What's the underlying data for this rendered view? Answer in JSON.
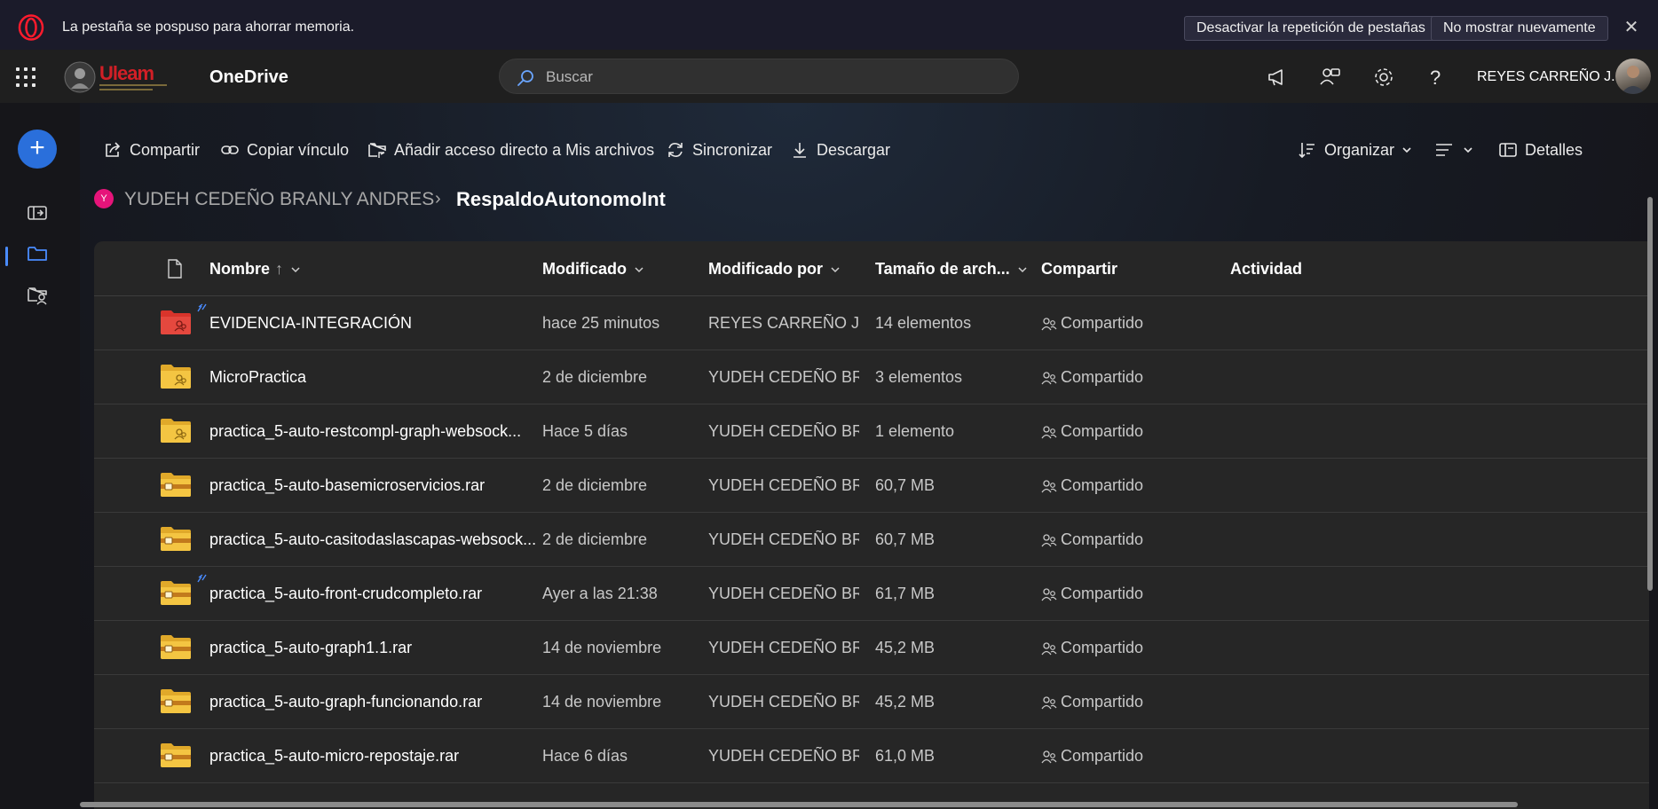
{
  "notification": {
    "text": "La pestaña se pospuso para ahorrar memoria.",
    "btn_disable": "Desactivar la repetición de pestañas",
    "btn_dont_show": "No mostrar nuevamente",
    "close": "✕"
  },
  "header": {
    "app_title": "OneDrive",
    "search_placeholder": "Buscar",
    "user_name": "REYES CARREÑO J...",
    "logo_text": "Uleam"
  },
  "commands": {
    "share": "Compartir",
    "copy_link": "Copiar vínculo",
    "add_shortcut": "Añadir acceso directo a Mis archivos",
    "sync": "Sincronizar",
    "download": "Descargar",
    "organize": "Organizar",
    "details": "Detalles"
  },
  "breadcrumb": {
    "avatar_letter": "Y",
    "parent": "YUDEH CEDEÑO BRANLY ANDRES",
    "separator": "›",
    "current": "RespaldoAutonomoInt"
  },
  "table": {
    "columns": {
      "name": "Nombre",
      "name_sort": "↑",
      "modified": "Modificado",
      "modified_by": "Modificado por",
      "size": "Tamaño de arch...",
      "sharing": "Compartir",
      "activity": "Actividad"
    },
    "rows": [
      {
        "name": "EVIDENCIA-INTEGRACIÓN",
        "modified": "hace 25 minutos",
        "modified_by": "REYES CARREÑO JESU",
        "size": "14 elementos",
        "sharing": "Compartido",
        "type": "folder-shared-red",
        "new": true
      },
      {
        "name": "MicroPractica",
        "modified": "2 de diciembre",
        "modified_by": "YUDEH CEDEÑO BRAN",
        "size": "3 elementos",
        "sharing": "Compartido",
        "type": "folder-shared",
        "new": false
      },
      {
        "name": "practica_5-auto-restcompl-graph-websock...",
        "modified": "Hace 5 días",
        "modified_by": "YUDEH CEDEÑO BRAN",
        "size": "1 elemento",
        "sharing": "Compartido",
        "type": "folder-shared",
        "new": false
      },
      {
        "name": "practica_5-auto-basemicroservicios.rar",
        "modified": "2 de diciembre",
        "modified_by": "YUDEH CEDEÑO BRAN",
        "size": "60,7 MB",
        "sharing": "Compartido",
        "type": "archive",
        "new": false
      },
      {
        "name": "practica_5-auto-casitodaslascapas-websock...",
        "modified": "2 de diciembre",
        "modified_by": "YUDEH CEDEÑO BRAN",
        "size": "60,7 MB",
        "sharing": "Compartido",
        "type": "archive",
        "new": false
      },
      {
        "name": "practica_5-auto-front-crudcompleto.rar",
        "modified": "Ayer a las 21:38",
        "modified_by": "YUDEH CEDEÑO BRAN",
        "size": "61,7 MB",
        "sharing": "Compartido",
        "type": "archive",
        "new": true
      },
      {
        "name": "practica_5-auto-graph1.1.rar",
        "modified": "14 de noviembre",
        "modified_by": "YUDEH CEDEÑO BRAN",
        "size": "45,2 MB",
        "sharing": "Compartido",
        "type": "archive",
        "new": false
      },
      {
        "name": "practica_5-auto-graph-funcionando.rar",
        "modified": "14 de noviembre",
        "modified_by": "YUDEH CEDEÑO BRAN",
        "size": "45,2 MB",
        "sharing": "Compartido",
        "type": "archive",
        "new": false
      },
      {
        "name": "practica_5-auto-micro-repostaje.rar",
        "modified": "Hace 6 días",
        "modified_by": "YUDEH CEDEÑO BRAN",
        "size": "61,0 MB",
        "sharing": "Compartido",
        "type": "archive",
        "new": false
      }
    ]
  },
  "colors": {
    "accent": "#2a6fdb",
    "folder": "#f4c542",
    "folder_red": "#d9342b",
    "crumb_avatar": "#e6147a"
  }
}
